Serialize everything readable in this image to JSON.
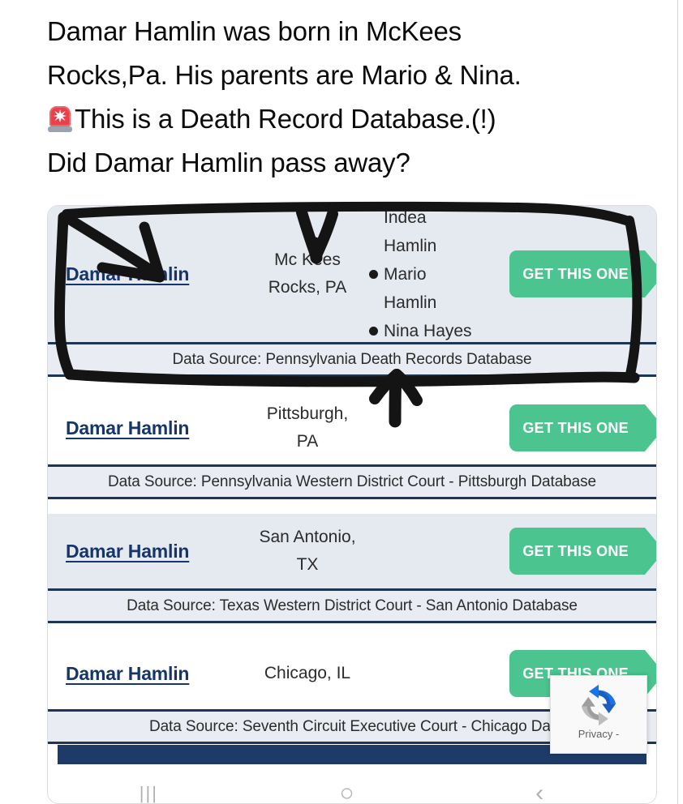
{
  "caption": {
    "line1": "Damar Hamlin was born in McKees",
    "line2": "Rocks,Pa. His parents are Mario & Nina.",
    "line3": "This is a Death Record Database.(!)",
    "line4": "Did Damar Hamlin pass away?",
    "siren_icon": "police-siren-icon"
  },
  "results": [
    {
      "name": "Damar Hamlin",
      "location_line1": "Mc Kees",
      "location_line2": "Rocks, PA",
      "relatives": [
        {
          "bullet": false,
          "text": "Indea"
        },
        {
          "bullet": false,
          "text": "Hamlin"
        },
        {
          "bullet": true,
          "text": "Mario"
        },
        {
          "bullet": false,
          "text": "Hamlin"
        },
        {
          "bullet": true,
          "text": "Nina Hayes"
        }
      ],
      "cta": "GET THIS ONE",
      "source": "Data Source: Pennsylvania Death Records Database"
    },
    {
      "name": "Damar Hamlin",
      "location_line1": "Pittsburgh,",
      "location_line2": "PA",
      "relatives": [],
      "cta": "GET THIS ONE",
      "source": "Data Source: Pennsylvania Western District Court - Pittsburgh Database"
    },
    {
      "name": "Damar Hamlin",
      "location_line1": "San Antonio,",
      "location_line2": "TX",
      "relatives": [],
      "cta": "GET THIS ONE",
      "source": "Data Source: Texas Western District Court - San Antonio Database"
    },
    {
      "name": "Damar Hamlin",
      "location_line1": "Chicago, IL",
      "location_line2": "",
      "relatives": [],
      "cta": "GET THIS ONE",
      "source": "Data Source: Seventh Circuit Executive Court - Chicago Dat"
    }
  ],
  "recaptcha": {
    "logo_icon": "recaptcha-logo-icon",
    "privacy_label": "Privacy -"
  },
  "nav_hints": {
    "recents": "|||",
    "home": "○",
    "back": "‹"
  },
  "colors": {
    "link": "#16356b",
    "cta_green": "#4bc490",
    "row_shaded": "#e5e9f0",
    "divider_navy": "#1d3557",
    "bottom_bar": "#1d3a68",
    "annotation_ink": "#111111"
  }
}
